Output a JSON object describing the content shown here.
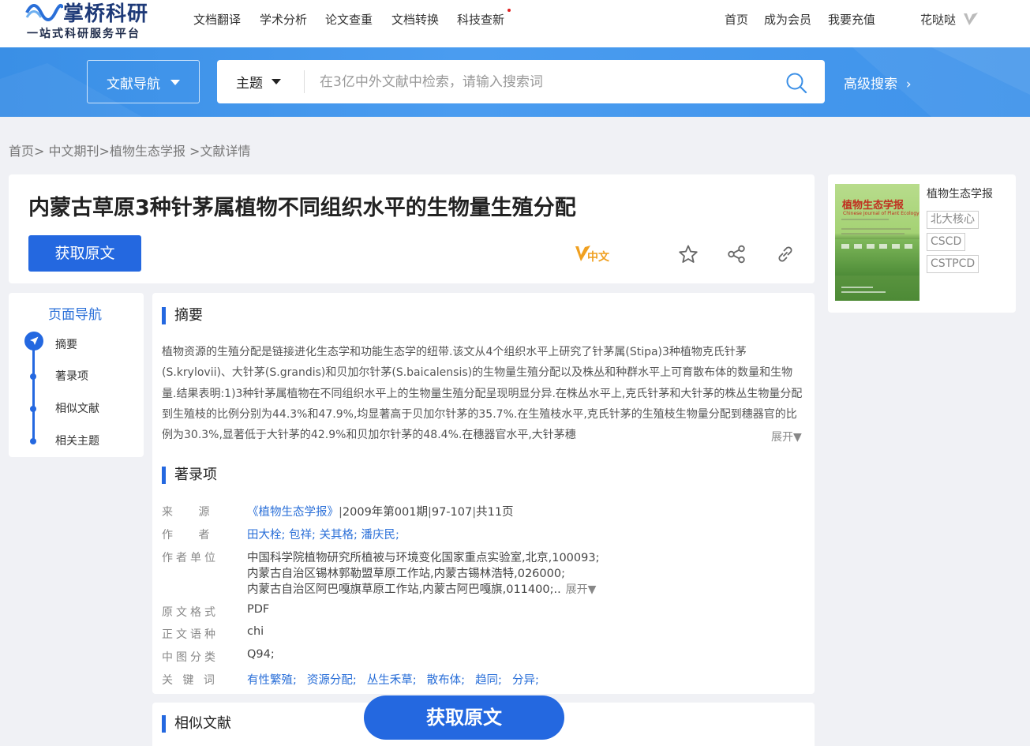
{
  "header": {
    "logo_name": "掌桥科研",
    "logo_slogan": "一站式科研服务平台",
    "nav": [
      "文档翻译",
      "学术分析",
      "论文查重",
      "文档转换",
      "科技查新"
    ],
    "right": [
      "首页",
      "成为会员",
      "我要充值"
    ],
    "username": "花哒哒"
  },
  "search": {
    "nav_dropdown": "文献导航",
    "scope": "主题",
    "placeholder": "在3亿中外文献中检索，请输入搜索词",
    "advanced": "高级搜索",
    "advanced_arrow": "›"
  },
  "breadcrumb": [
    "首页>",
    "中文期刊>",
    "植物生态学报",
    ">文献详情"
  ],
  "article": {
    "title": "内蒙古草原3种针茅属植物不同组织水平的生物量生殖分配",
    "get_button": "获取原文",
    "lang_badge": "中文"
  },
  "journal": {
    "name": "植物生态学报",
    "cover_title": "植物生态学报",
    "cover_sub": "Chinese Journal of Plant Ecology",
    "tags": [
      "北大核心",
      "CSCD",
      "CSTPCD"
    ]
  },
  "page_nav": {
    "title": "页面导航",
    "items": [
      "摘要",
      "著录项",
      "相似文献",
      "相关主题"
    ]
  },
  "abstract": {
    "heading": "摘要",
    "text": "植物资源的生殖分配是链接进化生态学和功能生态学的纽带.该文从4个组织水平上研究了针茅属(Stipa)3种植物克氏针茅(S.krylovii)、大针茅(S.grandis)和贝加尔针茅(S.baicalensis)的生物量生殖分配以及株丛和种群水平上可育散布体的数量和生物量.结果表明:1)3种针茅属植物在不同组织水平上的生物量生殖分配呈现明显分异.在株丛水平上,克氏针茅和大针茅的株丛生物量分配到生殖枝的比例分别为44.3%和47.9%,均显著高于贝加尔针茅的35.7%.在生殖枝水平,克氏针茅的生殖枝生物量分配到穗器官的比例为30.3%,显著低于大针茅的42.9%和贝加尔针茅的48.4%.在穗器官水平,大针茅穗",
    "expand": "展开▼"
  },
  "record": {
    "heading": "著录项",
    "source_label": "来 源",
    "source_journal": "《植物生态学报》",
    "source_issue": "2009年第001期",
    "source_pages": "97-107",
    "source_count": "共11页",
    "author_label": "作 者",
    "authors": "田大栓; 包祥; 关其格; 潘庆民;",
    "unit_label": "作者单位",
    "units": [
      "中国科学院植物研究所植被与环境变化国家重点实验室,北京,100093;",
      "内蒙古自治区锡林郭勒盟草原工作站,内蒙古锡林浩特,026000;",
      "内蒙古自治区阿巴嘎旗草原工作站,内蒙古阿巴嘎旗,011400;.."
    ],
    "unit_expand": "展开▼",
    "format_label": "原文格式",
    "format": "PDF",
    "lang_label": "正文语种",
    "lang": "chi",
    "clc_label": "中图分类",
    "clc": "Q94;",
    "kw_label": "关 键 词",
    "keywords": [
      "有性繁殖;",
      "资源分配;",
      "丛生禾草;",
      "散布体;",
      "趋同;",
      "分异;"
    ]
  },
  "similar": {
    "heading": "相似文献"
  },
  "float_button": "获取原文",
  "colors": {
    "primary": "#2468e0",
    "band": "#4a9cf0",
    "link": "#2a6fd8",
    "vip": "#f0a020"
  }
}
